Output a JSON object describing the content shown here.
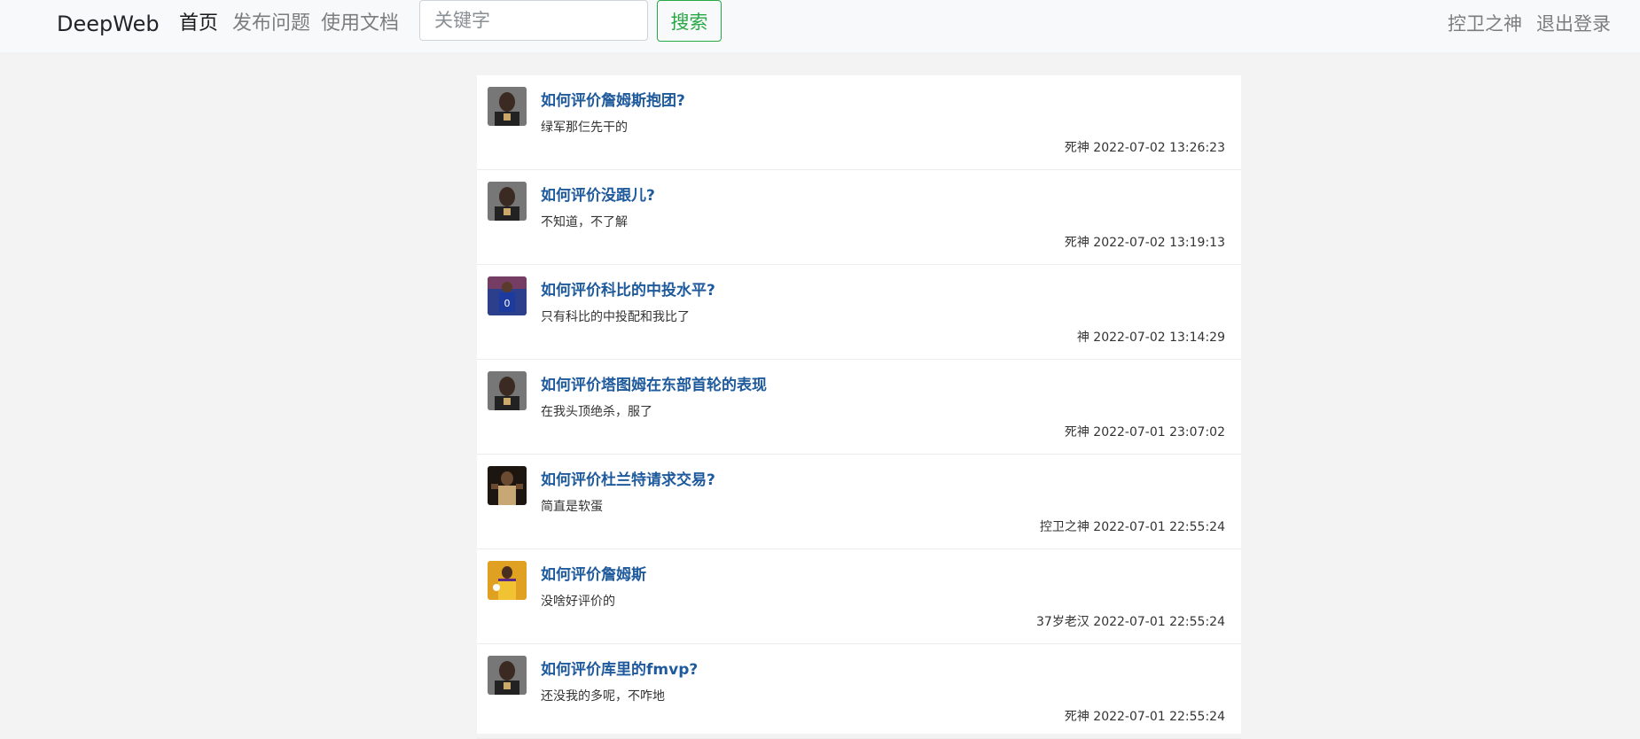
{
  "navbar": {
    "brand": "DeepWeb",
    "links": [
      {
        "label": "首页",
        "active": true
      },
      {
        "label": "发布问题",
        "active": false
      },
      {
        "label": "使用文档",
        "active": false
      }
    ],
    "search": {
      "placeholder": "关键字",
      "value": "",
      "button_label": "搜索"
    },
    "user_name": "控卫之神",
    "logout_label": "退出登录"
  },
  "questions": [
    {
      "title": "如何评价詹姆斯抱团?",
      "desc": "绿军那仨先干的",
      "author": "死神",
      "time": "2022-07-02 13:26:23",
      "avatar": "avatar-dark-player-icon"
    },
    {
      "title": "如何评价没跟儿?",
      "desc": "不知道，不了解",
      "author": "死神",
      "time": "2022-07-02 13:19:13",
      "avatar": "avatar-dark-player-icon"
    },
    {
      "title": "如何评价科比的中投水平?",
      "desc": "只有科比的中投配和我比了",
      "author": "神",
      "time": "2022-07-02 13:14:29",
      "avatar": "avatar-blue-jersey-icon"
    },
    {
      "title": "如何评价塔图姆在东部首轮的表现",
      "desc": "在我头顶绝杀，服了",
      "author": "死神",
      "time": "2022-07-01 23:07:02",
      "avatar": "avatar-dark-player-icon"
    },
    {
      "title": "如何评价杜兰特请求交易?",
      "desc": "简直是软蛋",
      "author": "控卫之神",
      "time": "2022-07-01 22:55:24",
      "avatar": "avatar-brown-player-icon"
    },
    {
      "title": "如何评价詹姆斯",
      "desc": "没啥好评价的",
      "author": "37岁老汉",
      "time": "2022-07-01 22:55:24",
      "avatar": "avatar-yellow-jersey-icon"
    },
    {
      "title": "如何评价库里的fmvp?",
      "desc": "还没我的多呢，不咋地",
      "author": "死神",
      "time": "2022-07-01 22:55:24",
      "avatar": "avatar-dark-player-icon"
    }
  ]
}
